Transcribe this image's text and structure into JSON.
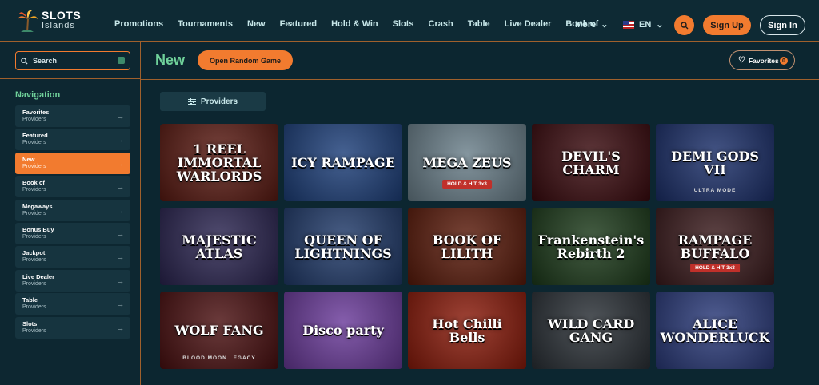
{
  "brand": {
    "line1": "SLOTS",
    "line2": "Islands"
  },
  "nav": [
    "Promotions",
    "Tournaments",
    "New",
    "Featured",
    "Hold & Win",
    "Slots",
    "Crash",
    "Table",
    "Live Dealer",
    "Book of"
  ],
  "more_label": "More",
  "lang_label": "EN",
  "signup_label": "Sign Up",
  "signin_label": "Sign In",
  "sidebar": {
    "search_placeholder": "Search",
    "nav_title": "Navigation",
    "items": [
      {
        "label": "Favorites",
        "sub": "Providers"
      },
      {
        "label": "Featured",
        "sub": "Providers"
      },
      {
        "label": "New",
        "sub": "Providers"
      },
      {
        "label": "Book of",
        "sub": "Providers"
      },
      {
        "label": "Megaways",
        "sub": "Providers"
      },
      {
        "label": "Bonus Buy",
        "sub": "Providers"
      },
      {
        "label": "Jackpot",
        "sub": "Providers"
      },
      {
        "label": "Live Dealer",
        "sub": "Providers"
      },
      {
        "label": "Table",
        "sub": "Providers"
      },
      {
        "label": "Slots",
        "sub": "Providers"
      }
    ]
  },
  "main": {
    "title": "New",
    "random_label": "Open Random Game",
    "favorites_label": "Favorites",
    "favorites_count": "0",
    "providers_label": "Providers"
  },
  "games": [
    {
      "name": "1 REEL IMMORTAL WARLORDS",
      "badge": "",
      "sub": "",
      "bg": "#5a1a12"
    },
    {
      "name": "ICY RAMPAGE",
      "badge": "",
      "sub": "",
      "bg": "#1d3f7a"
    },
    {
      "name": "MEGA ZEUS",
      "badge": "HOLD & HIT 3x3",
      "sub": "",
      "bg": "#6a7f8a"
    },
    {
      "name": "DEVIL'S CHARM",
      "badge": "",
      "sub": "",
      "bg": "#3a0a0e"
    },
    {
      "name": "DEMI GODS VII",
      "badge": "",
      "sub": "ULTRA MODE",
      "bg": "#1b2f6a"
    },
    {
      "name": "MAJESTIC ATLAS",
      "badge": "",
      "sub": "",
      "bg": "#2a2450"
    },
    {
      "name": "QUEEN OF LIGHTNINGS",
      "badge": "",
      "sub": "",
      "bg": "#203a6a"
    },
    {
      "name": "BOOK OF LILITH",
      "badge": "",
      "sub": "",
      "bg": "#5a1a0a"
    },
    {
      "name": "Frankenstein's Rebirth 2",
      "badge": "",
      "sub": "",
      "bg": "#1c3a1a"
    },
    {
      "name": "RAMPAGE BUFFALO",
      "badge": "HOLD & HIT 3x3",
      "sub": "",
      "bg": "#3a1a1c"
    },
    {
      "name": "WOLF FANG",
      "badge": "",
      "sub": "BLOOD MOON LEGACY",
      "bg": "#4a0f10"
    },
    {
      "name": "Disco party",
      "badge": "",
      "sub": "",
      "bg": "#6a3a9a"
    },
    {
      "name": "Hot Chilli Bells",
      "badge": "",
      "sub": "",
      "bg": "#8a1a0a"
    },
    {
      "name": "WILD CARD GANG",
      "badge": "",
      "sub": "",
      "bg": "#2a3036"
    },
    {
      "name": "ALICE WONDERLUCK",
      "badge": "",
      "sub": "",
      "bg": "#2a3a7a"
    }
  ]
}
